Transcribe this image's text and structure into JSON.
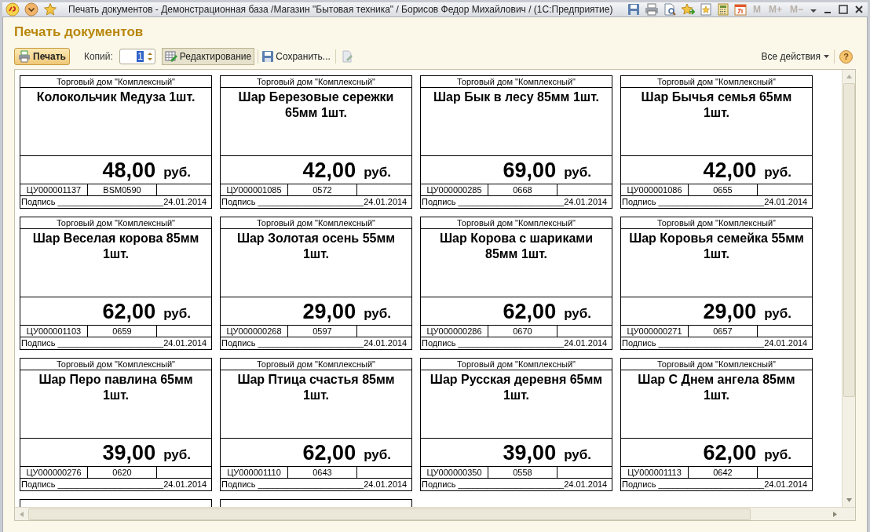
{
  "window": {
    "title": "Печать документов - Демонстрационная база /Магазин \"Бытовая техника\" / Борисов Федор Михайлович /  (1С:Предприятие)",
    "memory_buttons": [
      "M",
      "M+",
      "M−"
    ]
  },
  "heading": "Печать документов",
  "toolbar": {
    "print": "Печать",
    "copies_label": "Копий:",
    "copies": "1",
    "edit": {
      "label": "Редактирование",
      "selected": true
    },
    "save": "Сохранить...",
    "all_actions": "Все действия",
    "help": "?"
  },
  "labels": [
    {
      "org": "Торговый дом \"Комплексный\"",
      "name": "Колокольчик Медуза 1шт.",
      "price": "48,00",
      "currency": "руб.",
      "code": "ЦУ000001137",
      "article": "BSM0590",
      "sign": "Подпись ______________________",
      "date": "24.01.2014"
    },
    {
      "org": "Торговый дом \"Комплексный\"",
      "name": "Шар Березовые сережки 65мм 1шт.",
      "price": "42,00",
      "currency": "руб.",
      "code": "ЦУ000001085",
      "article": "0572",
      "sign": "Подпись ______________________",
      "date": "24.01.2014"
    },
    {
      "org": "Торговый дом \"Комплексный\"",
      "name": "Шар Бык в лесу 85мм 1шт.",
      "price": "69,00",
      "currency": "руб.",
      "code": "ЦУ000000285",
      "article": "0668",
      "sign": "Подпись ______________________",
      "date": "24.01.2014"
    },
    {
      "org": "Торговый дом \"Комплексный\"",
      "name": "Шар Бычья семья 65мм 1шт.",
      "price": "42,00",
      "currency": "руб.",
      "code": "ЦУ000001086",
      "article": "0655",
      "sign": "Подпись ______________________",
      "date": "24.01.2014"
    },
    {
      "org": "Торговый дом \"Комплексный\"",
      "name": "Шар Веселая корова 85мм 1шт.",
      "price": "62,00",
      "currency": "руб.",
      "code": "ЦУ000001103",
      "article": "0659",
      "sign": "Подпись ______________________",
      "date": "24.01.2014"
    },
    {
      "org": "Торговый дом \"Комплексный\"",
      "name": "Шар Золотая осень 55мм 1шт.",
      "price": "29,00",
      "currency": "руб.",
      "code": "ЦУ000000268",
      "article": "0597",
      "sign": "Подпись ______________________",
      "date": "24.01.2014"
    },
    {
      "org": "Торговый дом \"Комплексный\"",
      "name": "Шар Корова с шариками 85мм 1шт.",
      "price": "62,00",
      "currency": "руб.",
      "code": "ЦУ000000286",
      "article": "0670",
      "sign": "Подпись ______________________",
      "date": "24.01.2014"
    },
    {
      "org": "Торговый дом \"Комплексный\"",
      "name": "Шар Коровья семейка 55мм 1шт.",
      "price": "29,00",
      "currency": "руб.",
      "code": "ЦУ000000271",
      "article": "0657",
      "sign": "Подпись ______________________",
      "date": "24.01.2014"
    },
    {
      "org": "Торговый дом \"Комплексный\"",
      "name": "Шар Перо павлина 65мм 1шт.",
      "price": "39,00",
      "currency": "руб.",
      "code": "ЦУ000000276",
      "article": "0620",
      "sign": "Подпись ______________________",
      "date": "24.01.2014"
    },
    {
      "org": "Торговый дом \"Комплексный\"",
      "name": "Шар Птица счастья 85мм 1шт.",
      "price": "62,00",
      "currency": "руб.",
      "code": "ЦУ000001110",
      "article": "0643",
      "sign": "Подпись ______________________",
      "date": "24.01.2014"
    },
    {
      "org": "Торговый дом \"Комплексный\"",
      "name": "Шар Русская деревня 65мм 1шт.",
      "price": "39,00",
      "currency": "руб.",
      "code": "ЦУ000000350",
      "article": "0558",
      "sign": "Подпись ______________________",
      "date": "24.01.2014"
    },
    {
      "org": "Торговый дом \"Комплексный\"",
      "name": "Шар С Днем ангела 85мм 1шт.",
      "price": "62,00",
      "currency": "руб.",
      "code": "ЦУ000001113",
      "article": "0642",
      "sign": "Подпись ______________________",
      "date": "24.01.2014"
    }
  ]
}
